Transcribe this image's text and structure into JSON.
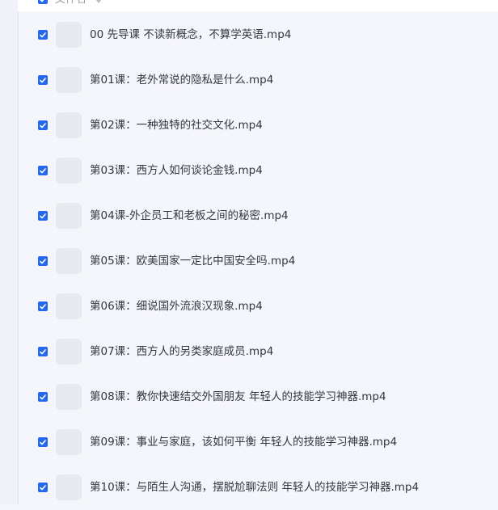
{
  "header": {
    "label": "文件名",
    "sort_icon": "sort-icon",
    "checked": true
  },
  "files": [
    {
      "name": "00 先导课 不读新概念，不算学英语.mp4",
      "checked": true
    },
    {
      "name": "第01课：老外常说的隐私是什么.mp4",
      "checked": true
    },
    {
      "name": "第02课：一种独特的社交文化.mp4",
      "checked": true
    },
    {
      "name": "第03课：西方人如何谈论金钱.mp4",
      "checked": true
    },
    {
      "name": "第04课-外企员工和老板之间的秘密.mp4",
      "checked": true
    },
    {
      "name": "第05课：欧美国家一定比中国安全吗.mp4",
      "checked": true
    },
    {
      "name": "第06课：细说国外流浪汉现象.mp4",
      "checked": true
    },
    {
      "name": "第07课：西方人的另类家庭成员.mp4",
      "checked": true
    },
    {
      "name": "第08课：教你快速结交外国朋友 年轻人的技能学习神器.mp4",
      "checked": true
    },
    {
      "name": "第09课：事业与家庭，该如何平衡 年轻人的技能学习神器.mp4",
      "checked": true
    },
    {
      "name": "第10课：与陌生人沟通，摆脱尬聊法则 年轻人的技能学习神器.mp4",
      "checked": true
    }
  ],
  "colors": {
    "checkbox": "#2468f2",
    "background": "#f5f6fb",
    "thumbnail": "#e7e9ef",
    "text": "#33373f"
  }
}
